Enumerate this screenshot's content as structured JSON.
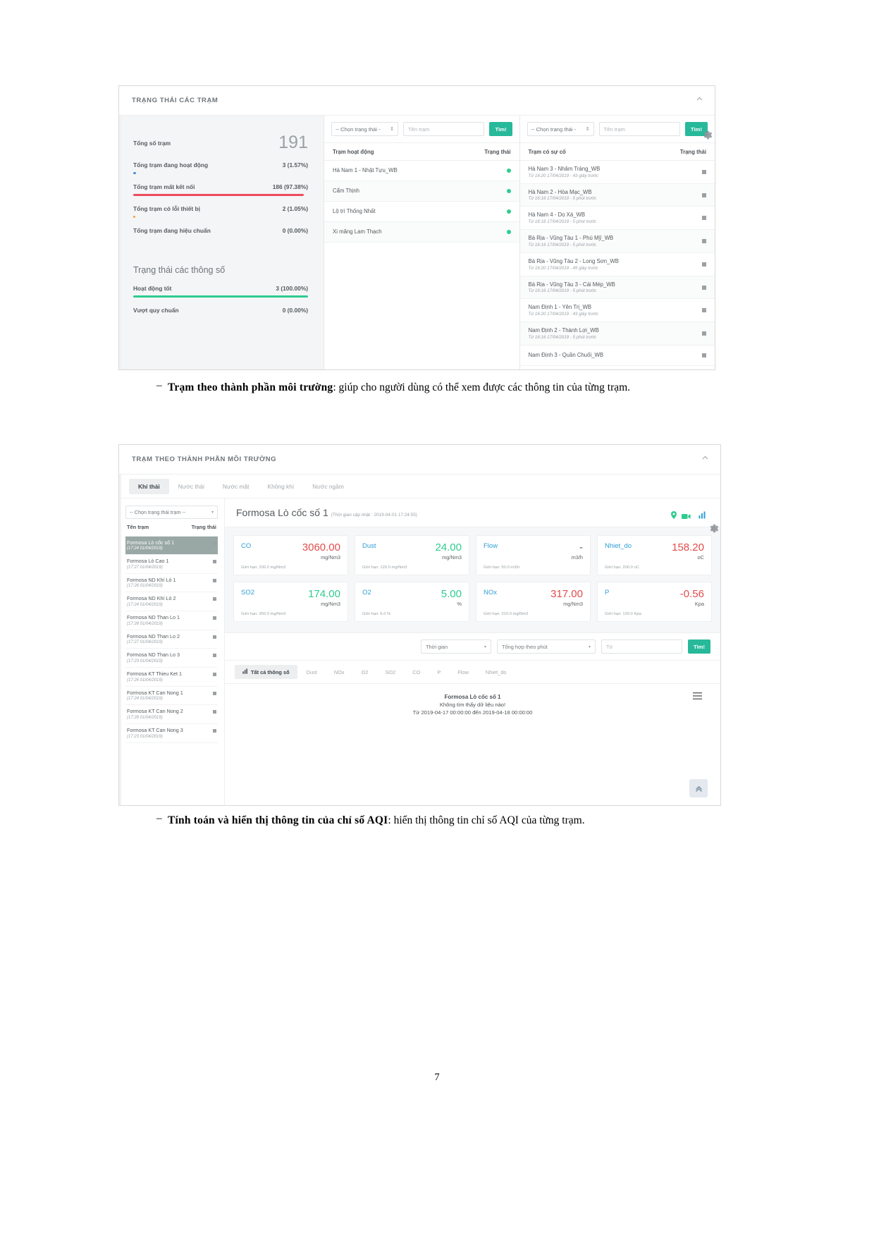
{
  "figure1": {
    "panel_title": "TRẠNG THÁI CÁC TRẠM",
    "collapse_icon": "chevron-up-icon",
    "stats": {
      "total_label": "Tổng số trạm",
      "total_value": "191",
      "rows": [
        {
          "label": "Tổng trạm đang hoạt động",
          "value": "3 (1.57%)",
          "bar_color": "#4a90d9",
          "bar_pct": 1.57
        },
        {
          "label": "Tổng trạm mất kết nối",
          "value": "186 (97.38%)",
          "bar_color": "#ef4b5f",
          "bar_pct": 97.38
        },
        {
          "label": "Tổng trạm có lỗi thiết bị",
          "value": "2 (1.05%)",
          "bar_color": "#f0a23c",
          "bar_pct": 1.05
        },
        {
          "label": "Tổng trạm đang hiệu chuẩn",
          "value": "0 (0.00%)",
          "bar_color": "#cccccc",
          "bar_pct": 0
        }
      ]
    },
    "params": {
      "title": "Trạng thái các thông số",
      "rows": [
        {
          "label": "Hoạt động tốt",
          "value": "3 (100.00%)",
          "bar_color": "#2ecc8f",
          "bar_pct": 100
        },
        {
          "label": "Vượt quy chuẩn",
          "value": "0 (0.00%)",
          "bar_color": "#cccccc",
          "bar_pct": 0
        }
      ]
    },
    "active_panel": {
      "status_select": "-- Chọn trạng thái -",
      "name_placeholder": "Tên trạm",
      "find_label": "Tìm!",
      "col_name": "Trạm hoạt động",
      "col_status": "Trạng thái",
      "rows": [
        {
          "name": "Hà Nam 1 - Nhật Tựu_WB",
          "status": "ok"
        },
        {
          "name": "Cẩm Thịnh",
          "status": "ok"
        },
        {
          "name": "Lộ trì Thống Nhất",
          "status": "ok"
        },
        {
          "name": "Xi măng Lam Thạch",
          "status": "ok"
        }
      ]
    },
    "incident_panel": {
      "status_select": "-- Chọn trạng thái -",
      "name_placeholder": "Tên trạm",
      "find_label": "Tìm!",
      "col_name": "Trạm có sự cố",
      "col_status": "Trạng thái",
      "rows": [
        {
          "name": "Hà Nam 3 - Nhâm Tràng_WB",
          "time": "Từ 16:20 17/04/2019 - 43 giây trước"
        },
        {
          "name": "Hà Nam 2 - Hòa Mạc_WB",
          "time": "Từ 16:16 17/04/2019 - 5 phút trước"
        },
        {
          "name": "Hà Nam 4 - Dọ Xá_WB",
          "time": "Từ 16:16 17/04/2019 - 5 phút trước"
        },
        {
          "name": "Bà Rịa - Vũng Tàu 1 - Phú Mỹ_WB",
          "time": "Từ 16:16 17/04/2019 - 5 phút trước"
        },
        {
          "name": "Bà Rịa - Vũng Tàu 2 - Long Sơn_WB",
          "time": "Từ 16:20 17/04/2019 - 45 giây trước"
        },
        {
          "name": "Bà Rịa - Vũng Tàu 3 - Cái Mép_WB",
          "time": "Từ 16:16 17/04/2019 - 5 phút trước"
        },
        {
          "name": "Nam Định 1 - Yên Trị_WB",
          "time": "Từ 16:20 17/04/2019 - 43 giây trước"
        },
        {
          "name": "Nam Định 2 - Thành Lợi_WB",
          "time": "Từ 16:16 17/04/2019 - 5 phút trước"
        },
        {
          "name": "Nam Định 3 - Quần Chuối_WB",
          "time": ""
        }
      ]
    },
    "gear_icon": "gear-icon"
  },
  "text1": {
    "dash": "–",
    "bold": "Trạm theo thành phần môi trường",
    "rest": ": giúp cho người dùng có thể xem được các thông tin của từng trạm."
  },
  "figure2": {
    "panel_title": "TRẠM THEO THÀNH PHẦN MÔI TRƯỜNG",
    "collapse_icon": "chevron-up-icon",
    "gear_icon": "gear-icon",
    "tabs": [
      {
        "label": "Khí thải",
        "active": true
      },
      {
        "label": "Nước thải",
        "active": false
      },
      {
        "label": "Nước mặt",
        "active": false
      },
      {
        "label": "Không khí",
        "active": false
      },
      {
        "label": "Nước ngầm",
        "active": false
      }
    ],
    "station_filter": "-- Chọn trạng thái trạm --",
    "col_name": "Tên trạm",
    "col_status": "Trạng thái",
    "stations": [
      {
        "name": "Formosa Lò cốc số 1",
        "time": "(17:24 01/04/2019)",
        "selected": true
      },
      {
        "name": "Formosa Lò Cao 1",
        "time": "(17:27 01/04/2019)",
        "selected": false
      },
      {
        "name": "Formosa ND Khí Lò 1",
        "time": "(17:26 01/04/2019)",
        "selected": false
      },
      {
        "name": "Formosa ND Khí Lò 2",
        "time": "(17:24 01/04/2019)",
        "selected": false
      },
      {
        "name": "Formosa ND Than Lo 1",
        "time": "(17:28 01/04/2019)",
        "selected": false
      },
      {
        "name": "Formosa ND Than Lo 2",
        "time": "(17:27 01/04/2019)",
        "selected": false
      },
      {
        "name": "Formosa ND Than Lo 3",
        "time": "(17:23 01/04/2019)",
        "selected": false
      },
      {
        "name": "Formosa KT Thieu Ket 1",
        "time": "(17:26 01/04/2019)",
        "selected": false
      },
      {
        "name": "Formosa KT Can Nong 1",
        "time": "(17:24 01/04/2019)",
        "selected": false
      },
      {
        "name": "Formosa KT Can Nong 2",
        "time": "(17:28 01/04/2019)",
        "selected": false
      },
      {
        "name": "Formosa KT Can Nong 3",
        "time": "(17:23 01/04/2019)",
        "selected": false
      }
    ],
    "station_title": "Formosa Lò cốc số 1",
    "station_updated": "(Thời gian cập nhật : 2019-04-01 17:24:55)",
    "header_icons": [
      "location-pin-icon",
      "video-camera-icon",
      "bar-chart-icon"
    ],
    "cards": [
      {
        "key": "CO",
        "value": "3060.00",
        "unit": "mg/Nm3",
        "limit": "Giới hạn: 200.0 mg/Nm3",
        "color": "#e24c4c"
      },
      {
        "key": "Dust",
        "value": "24.00",
        "unit": "mg/Nm3",
        "limit": "Giới hạn: 120.0 mg/Nm3",
        "color": "#2ecc8f"
      },
      {
        "key": "Flow",
        "value": "-",
        "unit": "m3/h",
        "limit": "Giới hạn: 50.0 m3/h",
        "color": "#5d6165"
      },
      {
        "key": "Nhiet_do",
        "value": "158.20",
        "unit": "oC",
        "limit": "Giới hạn: 200.0 oC",
        "color": "#e24c4c"
      },
      {
        "key": "SO2",
        "value": "174.00",
        "unit": "mg/Nm3",
        "limit": "Giới hạn: 350.0 mg/Nm3",
        "color": "#2ecc8f"
      },
      {
        "key": "O2",
        "value": "5.00",
        "unit": "%",
        "limit": "Giới hạn: 6.0 %",
        "color": "#2ecc8f"
      },
      {
        "key": "NOx",
        "value": "317.00",
        "unit": "mg/Nm3",
        "limit": "Giới hạn: 310.0 mg/Nm3",
        "color": "#e24c4c"
      },
      {
        "key": "P",
        "value": "-0.56",
        "unit": "Kpa",
        "limit": "Giới hạn: 120.0 Kpa",
        "color": "#e24c4c"
      }
    ],
    "filters": {
      "time_label": "Thời gian",
      "aggregate_label": "Tổng hợp theo phút",
      "from_placeholder": "Từ",
      "find_label": "Tìm!"
    },
    "param_tabs": [
      {
        "label": "Tất cả thông số",
        "active": true
      },
      {
        "label": "Dust",
        "active": false
      },
      {
        "label": "NOx",
        "active": false
      },
      {
        "label": "O2",
        "active": false
      },
      {
        "label": "SO2",
        "active": false
      },
      {
        "label": "CO",
        "active": false
      },
      {
        "label": "P",
        "active": false
      },
      {
        "label": "Flow",
        "active": false
      },
      {
        "label": "Nhiet_do",
        "active": false
      }
    ],
    "chart": {
      "title": "Formosa Lò cốc số 1",
      "empty_msg": "Không tìm thấy dữ liệu nào!",
      "range": "Từ 2019-04-17 00:00:00 đến 2019-04-18 00:00:00",
      "menu_icon": "hamburger-menu-icon",
      "scroll_top_icon": "double-chevron-up-icon"
    }
  },
  "text2": {
    "dash": "–",
    "bold": "Tính toán và hiển thị thông tin của chỉ số AQI",
    "rest": ": hiển thị thông tin chỉ số AQI của từng trạm."
  },
  "page_number": "7"
}
